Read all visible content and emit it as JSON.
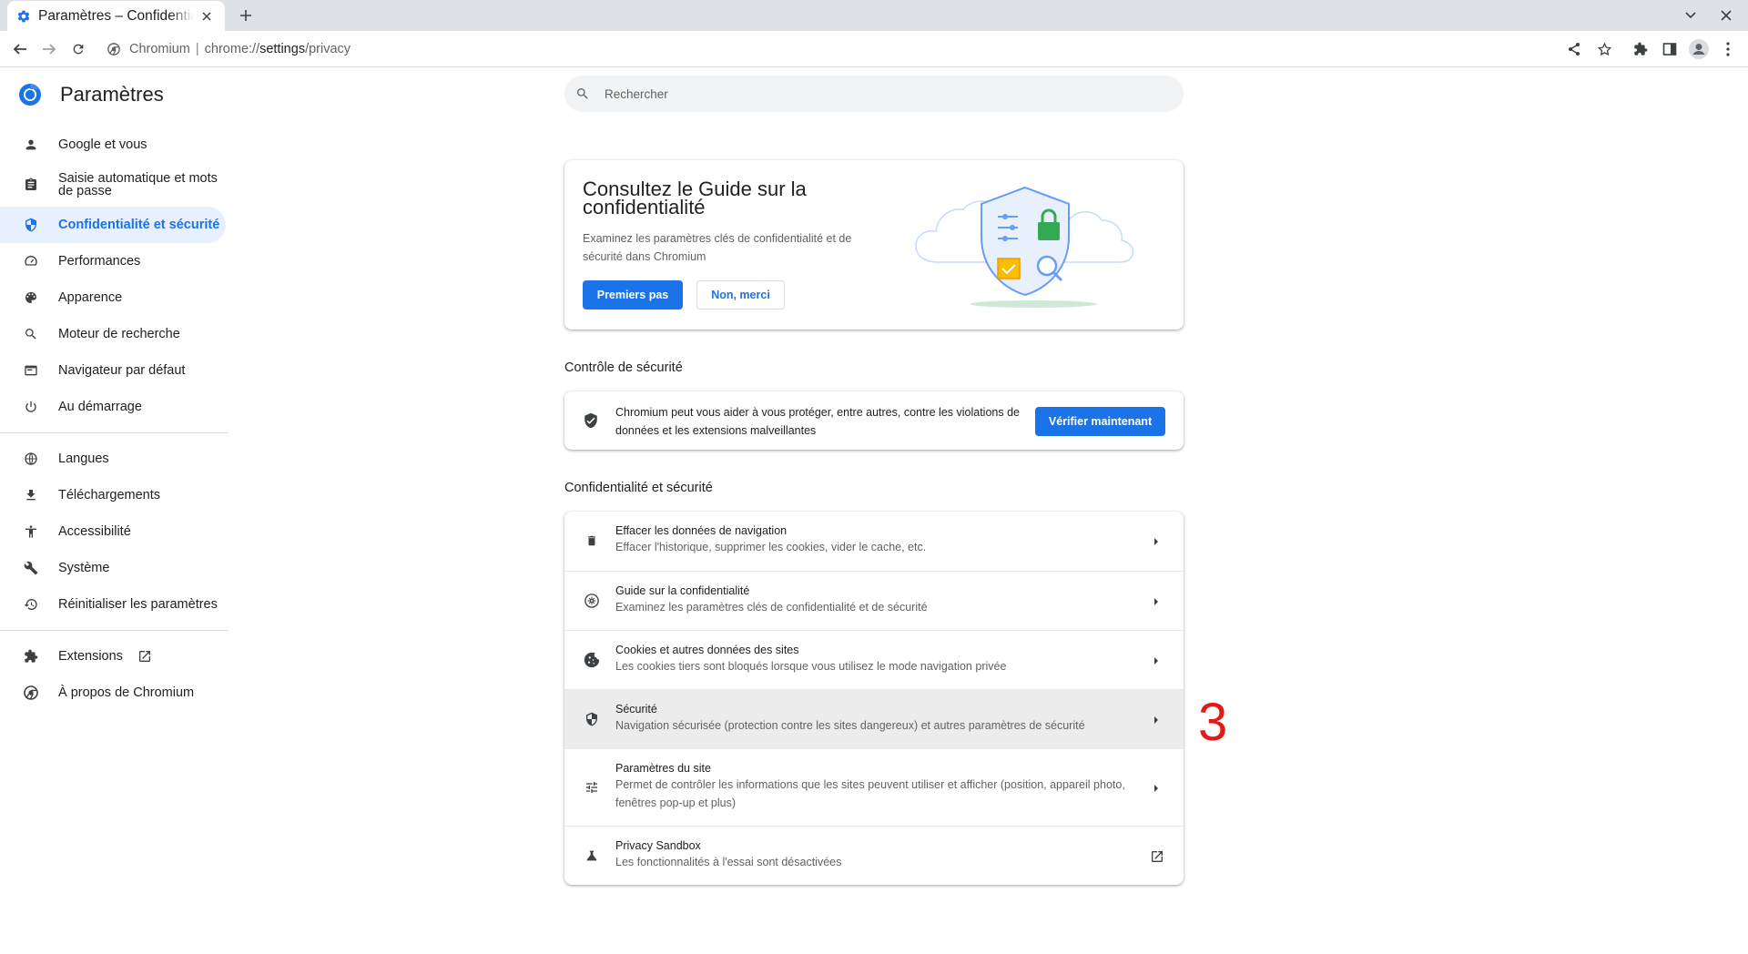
{
  "browser": {
    "tab_title": "Paramètres – Confidentialité et sécurité",
    "omnibox_host": "Chromium",
    "omnibox_url_scheme": "chrome://",
    "omnibox_url_path": "settings",
    "omnibox_url_rest": "/privacy"
  },
  "sidebar": {
    "title": "Paramètres",
    "items": [
      {
        "label": "Google et vous",
        "icon": "person-icon"
      },
      {
        "label": "Saisie automatique et mots de passe",
        "icon": "clipboard-icon"
      },
      {
        "label": "Confidentialité et sécurité",
        "icon": "shield-icon",
        "active": true
      },
      {
        "label": "Performances",
        "icon": "speedometer-icon"
      },
      {
        "label": "Apparence",
        "icon": "palette-icon"
      },
      {
        "label": "Moteur de recherche",
        "icon": "search-icon"
      },
      {
        "label": "Navigateur par défaut",
        "icon": "browser-icon"
      },
      {
        "label": "Au démarrage",
        "icon": "power-icon"
      },
      {
        "label": "Langues",
        "icon": "globe-icon"
      },
      {
        "label": "Téléchargements",
        "icon": "download-icon"
      },
      {
        "label": "Accessibilité",
        "icon": "accessibility-icon"
      },
      {
        "label": "Système",
        "icon": "wrench-icon"
      },
      {
        "label": "Réinitialiser les paramètres",
        "icon": "restore-icon"
      },
      {
        "label": "Extensions",
        "icon": "puzzle-icon"
      },
      {
        "label": "À propos de Chromium",
        "icon": "chromium-icon"
      }
    ]
  },
  "search": {
    "placeholder": "Rechercher"
  },
  "guide_card": {
    "title": "Consultez le Guide sur la confidentialité",
    "description": "Examinez les paramètres clés de confidentialité et de sécurité dans Chromium",
    "primary_button": "Premiers pas",
    "secondary_button": "Non, merci"
  },
  "safety_check": {
    "section_title": "Contrôle de sécurité",
    "text": "Chromium peut vous aider à vous protéger, entre autres, contre les violations de données et les extensions malveillantes",
    "button": "Vérifier maintenant"
  },
  "privacy_section": {
    "section_title": "Confidentialité et sécurité",
    "rows": [
      {
        "title": "Effacer les données de navigation",
        "subtitle": "Effacer l'historique, supprimer les cookies, vider le cache, etc.",
        "icon": "trash-icon"
      },
      {
        "title": "Guide sur la confidentialité",
        "subtitle": "Examinez les paramètres clés de confidentialité et de sécurité",
        "icon": "compass-icon"
      },
      {
        "title": "Cookies et autres données des sites",
        "subtitle": "Les cookies tiers sont bloqués lorsque vous utilisez le mode navigation privée",
        "icon": "cookie-icon"
      },
      {
        "title": "Sécurité",
        "subtitle": "Navigation sécurisée (protection contre les sites dangereux) et autres paramètres de sécurité",
        "icon": "security-shield-icon"
      },
      {
        "title": "Paramètres du site",
        "subtitle": "Permet de contrôler les informations que les sites peuvent utiliser et afficher (position, appareil photo, fenêtres pop-up et plus)",
        "icon": "sliders-icon"
      },
      {
        "title": "Privacy Sandbox",
        "subtitle": "Les fonctionnalités à l'essai sont désactivées",
        "icon": "flask-icon"
      }
    ]
  },
  "annotation": "3",
  "colors": {
    "accent": "#1a73e8",
    "active_bg": "#e8f0fe",
    "annotation": "#e41a1a"
  }
}
